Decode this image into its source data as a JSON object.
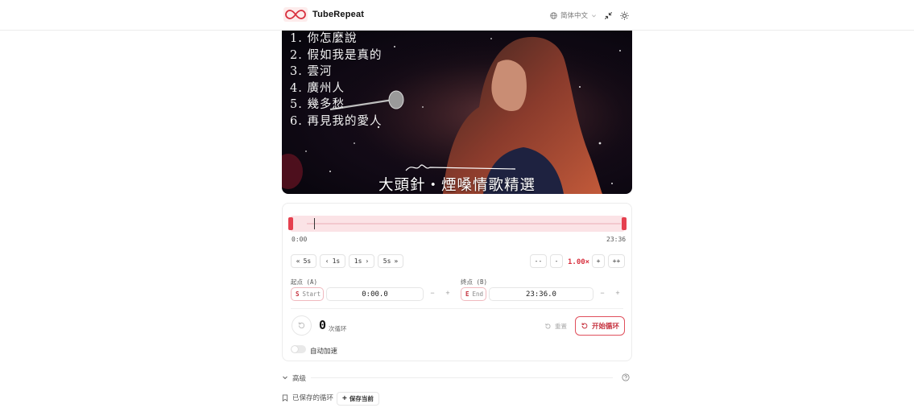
{
  "app": {
    "name": "TubeRepeat",
    "language": "简体中文"
  },
  "video": {
    "song_list": [
      "1. 你怎麼說",
      "2. 假如我是真的",
      "3. 雲河",
      "4. 廣州人",
      "5. 幾多愁",
      "6. 再見我的愛人"
    ],
    "caption": "大頭針・煙嗓情歌精選"
  },
  "timeline": {
    "start_time": "0:00",
    "end_time": "23:36",
    "playhead_fraction": 0.045
  },
  "controls": {
    "back_5s": "5s",
    "back_1s": "1s",
    "fwd_1s": "1s",
    "fwd_5s": "5s",
    "speed_down_more": "--",
    "speed_down": "-",
    "speed_value": "1.00×",
    "speed_up": "+",
    "speed_up_more": "++"
  },
  "loop_start": {
    "label": "起点 (A)",
    "key": "S",
    "word": "Start",
    "value": "0:00.0",
    "minus": "−",
    "plus": "+"
  },
  "loop_end": {
    "label": "终点 (B)",
    "key": "E",
    "word": "End",
    "value": "23:36.0",
    "minus": "−",
    "plus": "+"
  },
  "counter": {
    "count": "0",
    "unit": "次循环",
    "reset_label": "重置",
    "start_loop_label": "开始循环"
  },
  "auto_speed": {
    "label": "自动加速",
    "enabled": false
  },
  "advanced": {
    "label": "高级"
  },
  "saved": {
    "label": "已保存的循环",
    "save_current_label": "保存当前"
  },
  "colors": {
    "accent": "#d8303e",
    "track": "#fbe3e6"
  }
}
